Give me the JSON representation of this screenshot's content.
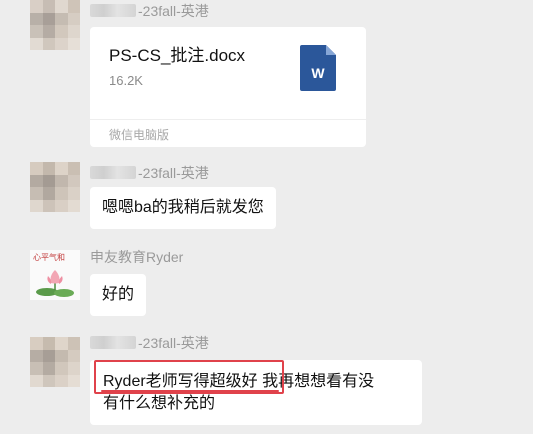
{
  "messages": [
    {
      "sender_suffix": "-23fall-英港",
      "file": {
        "name": "PS-CS_批注.docx",
        "size": "16.2K",
        "source": "微信电脑版",
        "icon_letter": "W",
        "icon_color": "#2b579a"
      }
    },
    {
      "sender_suffix": "-23fall-英港",
      "text": "嗯嗯ba的我稍后就发您"
    },
    {
      "sender": "申友教育Ryder",
      "avatar_caption": "心平气和",
      "text": "好的"
    },
    {
      "sender_suffix": "-23fall-英港",
      "text_line1_highlighted": "Ryder老师写得超级好",
      "text_line1_rest": " 我再想想看有没",
      "text_line2": "有什么想补充的"
    }
  ],
  "colors": {
    "background": "#ededed",
    "bubble": "#ffffff",
    "annotation_red": "#e0424b"
  }
}
